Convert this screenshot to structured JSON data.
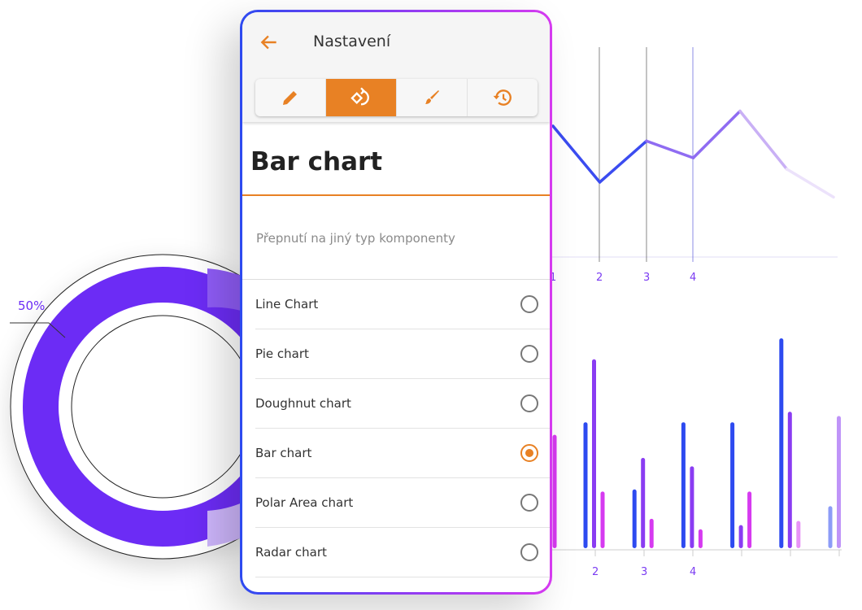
{
  "header": {
    "title": "Nastavení",
    "back_icon": "arrow-left-icon"
  },
  "toolbar": {
    "tabs": [
      {
        "icon": "pencil-icon",
        "active": false
      },
      {
        "icon": "switch-type-icon",
        "active": true
      },
      {
        "icon": "brush-icon",
        "active": false
      },
      {
        "icon": "history-icon",
        "active": false
      }
    ]
  },
  "section": {
    "title": "Bar chart",
    "subtitle": "Přepnutí na jiný typ komponenty"
  },
  "options": [
    {
      "label": "Line Chart",
      "selected": false
    },
    {
      "label": "Pie chart",
      "selected": false
    },
    {
      "label": "Doughnut chart",
      "selected": false
    },
    {
      "label": "Bar chart",
      "selected": true
    },
    {
      "label": "Polar Area chart",
      "selected": false
    },
    {
      "label": "Radar chart",
      "selected": false
    }
  ],
  "colors": {
    "accent": "#e88124",
    "blue": "#2d4af0",
    "purple": "#8a3cf2",
    "magenta": "#d63af0",
    "doughnut": "#6c2cf5"
  },
  "decor": {
    "doughnut_label": "50%",
    "line_chart": {
      "x_labels": [
        "1",
        "2",
        "3",
        "4"
      ],
      "values": [
        70,
        40,
        62,
        53,
        78,
        47,
        32
      ]
    },
    "bar_chart": {
      "x_labels": [
        "2",
        "3",
        "4"
      ],
      "series": [
        {
          "color": "blue",
          "values": [
            null,
            60,
            28,
            60,
            60,
            100,
            20
          ]
        },
        {
          "color": "purple",
          "values": [
            null,
            90,
            43,
            39,
            11,
            65,
            63
          ]
        },
        {
          "color": "magenta",
          "values": [
            54,
            27,
            14,
            9,
            27,
            13,
            null
          ]
        }
      ]
    }
  }
}
